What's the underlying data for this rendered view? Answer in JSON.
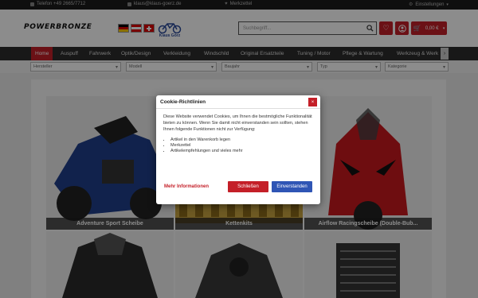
{
  "topbar": {
    "phone": "Telefon +49 2665/7712",
    "email": "klaus@klaus-goerz.de",
    "wishlist": "Merkzettel",
    "settings": "Einstellungen"
  },
  "header": {
    "logo_text": "POWERBRONZE",
    "brand_caption": "Klaus Görz",
    "search_placeholder": "Suchbegriff...",
    "cart_amount": "0,00 €",
    "cart_count": "0"
  },
  "nav": {
    "tabs": [
      "Home",
      "Auspuff",
      "Fahrwerk",
      "Optik/Design",
      "Verkleidung",
      "Windschild",
      "Original Ersatzteile",
      "Tuning / Motor",
      "Pflege & Wartung",
      "Werkzeug & Werk"
    ]
  },
  "filters": {
    "selects": [
      "Hersteller",
      "Modell",
      "Baujahr",
      "Typ",
      "Kategorie"
    ]
  },
  "products": [
    {
      "caption": "Adventure Sport Scheibe"
    },
    {
      "caption": "Kettenkits"
    },
    {
      "caption": "Airflow Racingscheibe (Double-Bub..."
    },
    {
      "caption": ""
    },
    {
      "caption": ""
    },
    {
      "caption": ""
    }
  ],
  "cookie": {
    "title": "Cookie-Richtlinien",
    "text": "Diese Website verwendet Cookies, um Ihnen die bestmögliche Funktionalität bieten zu können. Wenn Sie damit nicht einverstanden sein sollten, stehen Ihnen folgende Funktionen nicht zur Verfügung:",
    "items": [
      "Artikel in den Warenkorb legen",
      "Merkzettel",
      "Artikelempfehlungen und vieles mehr"
    ],
    "more_link": "Mehr Informationen",
    "decline": "Schließen",
    "accept": "Einverstanden"
  },
  "colors": {
    "accent_red": "#c41f28",
    "accept_blue": "#2f55b5",
    "nav_bg": "#2d2d2d"
  }
}
